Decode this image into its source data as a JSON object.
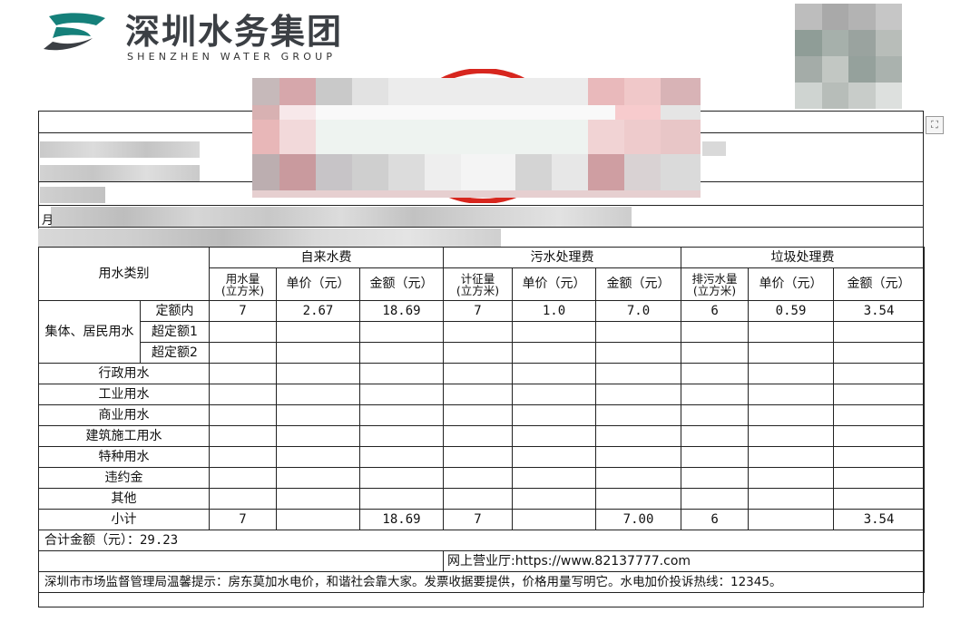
{
  "brand": {
    "title": "深圳水务集团",
    "subtitle": "SHENZHEN WATER GROUP",
    "colors": {
      "teal": "#15807a",
      "dark": "#3b3f44"
    }
  },
  "icons": {
    "side": "fullscreen-icon"
  },
  "fields": {
    "month_label": "月"
  },
  "table": {
    "category_header": "用水类别",
    "groups": [
      "自来水费",
      "污水处理费",
      "垃圾处理费"
    ],
    "subheaders": [
      "用水量\n(立方米)",
      "单价（元）",
      "金额（元）",
      "计征量\n(立方米)",
      "单价（元）",
      "金额（元）",
      "排污水量\n(立方米)",
      "单价（元）",
      "金额（元）"
    ],
    "residential_label": "集体、居民用水",
    "tiers": [
      "定额内",
      "超定额1",
      "超定额2"
    ],
    "tier_rows": [
      [
        "7",
        "2.67",
        "18.69",
        "7",
        "1.0",
        "7.0",
        "6",
        "0.59",
        "3.54"
      ],
      [
        "",
        "",
        "",
        "",
        "",
        "",
        "",
        "",
        ""
      ],
      [
        "",
        "",
        "",
        "",
        "",
        "",
        "",
        "",
        ""
      ]
    ],
    "other_rows": [
      {
        "label": "行政用水"
      },
      {
        "label": "工业用水"
      },
      {
        "label": "商业用水"
      },
      {
        "label": "建筑施工用水"
      },
      {
        "label": "特种用水"
      },
      {
        "label": "违约金"
      },
      {
        "label": "其他"
      }
    ],
    "subtotal": {
      "label": "小计",
      "values": [
        "7",
        "",
        "18.69",
        "7",
        "",
        "7.00",
        "6",
        "",
        "3.54"
      ]
    },
    "total_text": "合计金额（元）：",
    "total_value": "29.23",
    "online_hall": "网上营业厅:https://www.82137777.com",
    "notice": "深圳市市场监督管理局温馨提示：房东莫加水电价，和谐社会靠大家。发票收据要提供，价格用量写明它。水电加价投诉热线：12345。"
  }
}
